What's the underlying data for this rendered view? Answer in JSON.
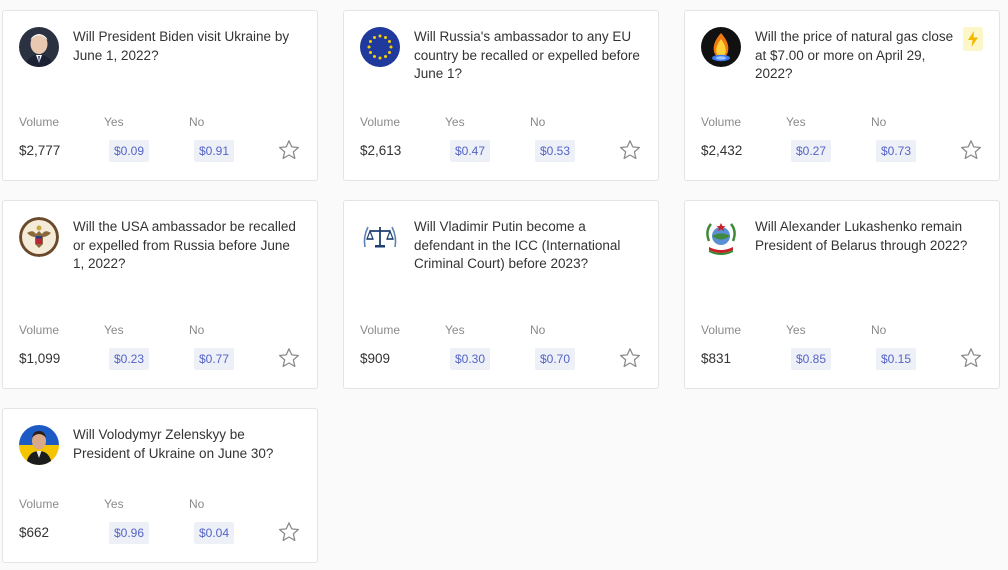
{
  "labels": {
    "volume": "Volume",
    "yes": "Yes",
    "no": "No"
  },
  "markets": [
    {
      "question": "Will President Biden visit Ukraine by June 1, 2022?",
      "volume": "$2,777",
      "yes": "$0.09",
      "no": "$0.91",
      "icon": "biden-portrait-icon"
    },
    {
      "question": "Will Russia's ambassador to any EU country be recalled or expelled before June 1?",
      "volume": "$2,613",
      "yes": "$0.47",
      "no": "$0.53",
      "icon": "eu-flag-icon"
    },
    {
      "question": "Will the price of natural gas close at $7.00 or more on April 29, 2022?",
      "volume": "$2,432",
      "yes": "$0.27",
      "no": "$0.73",
      "icon": "gas-flame-icon",
      "badge": "lightning-icon"
    },
    {
      "question": "Will the USA ambassador be recalled or expelled from Russia before June 1, 2022?",
      "volume": "$1,099",
      "yes": "$0.23",
      "no": "$0.77",
      "icon": "us-seal-icon"
    },
    {
      "question": "Will Vladimir Putin become a defendant in the ICC (International Criminal Court) before 2023?",
      "volume": "$909",
      "yes": "$0.30",
      "no": "$0.70",
      "icon": "icc-scales-icon"
    },
    {
      "question": "Will Alexander Lukashenko remain President of Belarus through 2022?",
      "volume": "$831",
      "yes": "$0.85",
      "no": "$0.15",
      "icon": "belarus-emblem-icon"
    },
    {
      "question": "Will Volodymyr Zelenskyy be President of Ukraine on June 30?",
      "volume": "$662",
      "yes": "$0.96",
      "no": "$0.04",
      "icon": "zelenskyy-portrait-icon"
    }
  ],
  "colors": {
    "price_text": "#5464c4",
    "price_bg": "#eef0f8",
    "bolt_bg": "#fdf6c8",
    "bolt": "#f5b800"
  }
}
